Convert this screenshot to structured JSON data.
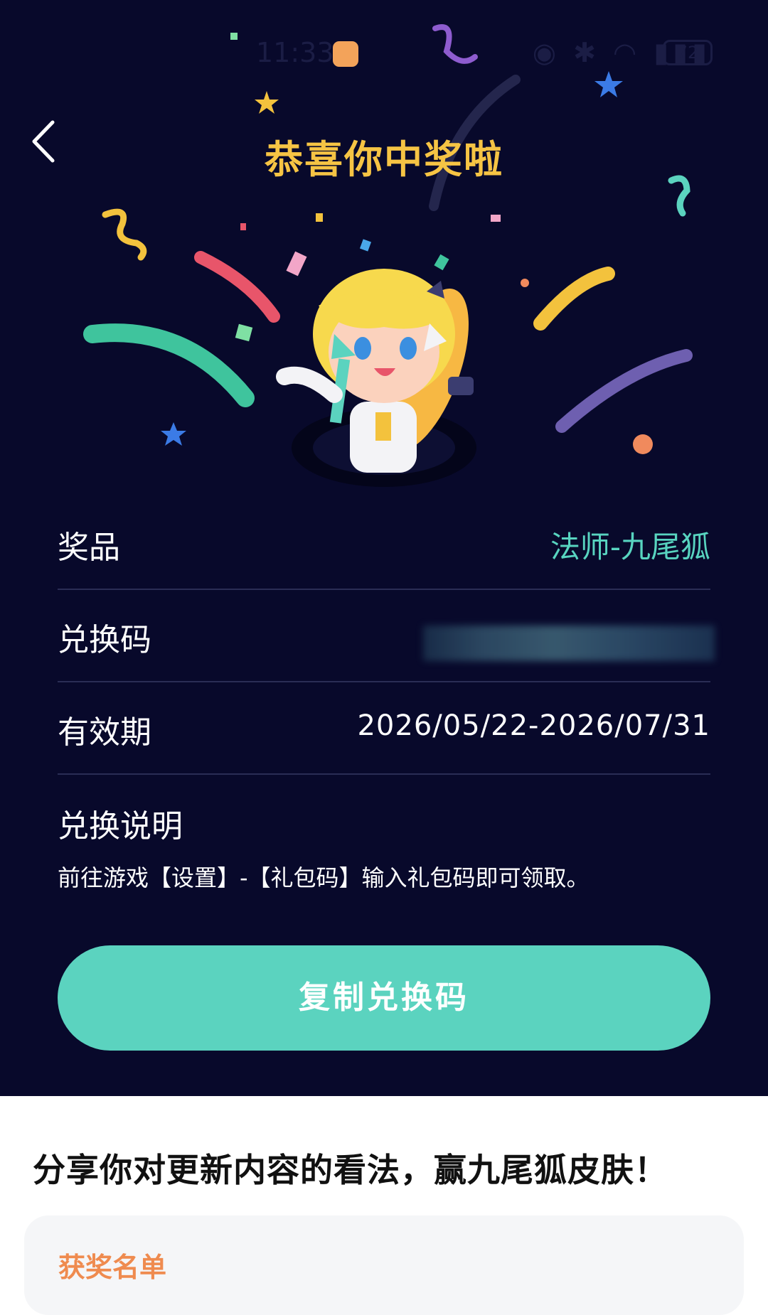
{
  "status_bar": {
    "time": "11:33",
    "battery": "72"
  },
  "header": {
    "title": "恭喜你中奖啦"
  },
  "details": {
    "prize_label": "奖品",
    "prize_value": "法师-九尾狐",
    "code_label": "兑换码",
    "validity_label": "有效期",
    "validity_value": "2026/05/22-2026/07/31"
  },
  "instructions": {
    "title": "兑换说明",
    "text": "前往游戏【设置】-【礼包码】输入礼包码即可领取。"
  },
  "copy_button": {
    "label": "复制兑换码"
  },
  "share": {
    "title": "分享你对更新内容的看法，赢九尾狐皮肤！"
  },
  "winners": {
    "label": "获奖名单"
  },
  "colors": {
    "background": "#08092b",
    "title": "#f6c444",
    "accent": "#5bd3bf",
    "winners_label": "#ef8b4f"
  },
  "icons": {
    "back": "chevron-left-icon"
  }
}
